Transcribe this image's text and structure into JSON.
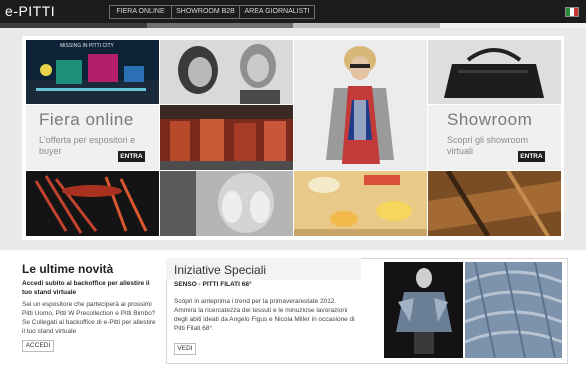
{
  "header": {
    "logo": "e-PITTI",
    "nav": [
      "FIERA ONLINE",
      "SHOWROOM B2B",
      "AREA GIORNALISTI"
    ]
  },
  "colors": {
    "topbar": "#1c1c1c",
    "stripe": [
      "#3d3d3d",
      "#6f6f6f",
      "#bdbdbd",
      "#f2f2f2"
    ],
    "flag": [
      "#2d8b3a",
      "#ffffff",
      "#c8332b"
    ]
  },
  "hero": {
    "fiera": {
      "title": "Fiera online",
      "sub": "L'offerta per espositori e buyer",
      "button": "ENTRA"
    },
    "showroom": {
      "title": "Showroom",
      "sub": "Scopri gli showroom virtuali",
      "button": "ENTRA"
    },
    "photo_caption": "MISSING IN PITTI CITY"
  },
  "news": {
    "title": "Le ultime novità",
    "highlight": "Accedi subito al backoffice per allestire il tuo stand virtuale",
    "body": "Sei un espositore che parteciperà ai prossimi Pitti Uomo, Pitti W Precollection e Pitti Bimbo? Se Collegati al backoffice di e-Pitti per allestire il tuo stand virtuale",
    "button": "ACCEDI"
  },
  "specials": {
    "title": "Iniziative Speciali",
    "subtitle": "SENSO - PITTI FILATI 68°",
    "body": "Scopri in anteprima i trend per la primavera/estate 2012. Ammira la ricercatezza dei tessuti e le minuziose lavorazioni degli abiti ideati da Angelo Figus e Nicola Miller in occasione di Pitti Filati 68°.",
    "button": "VEDI"
  }
}
